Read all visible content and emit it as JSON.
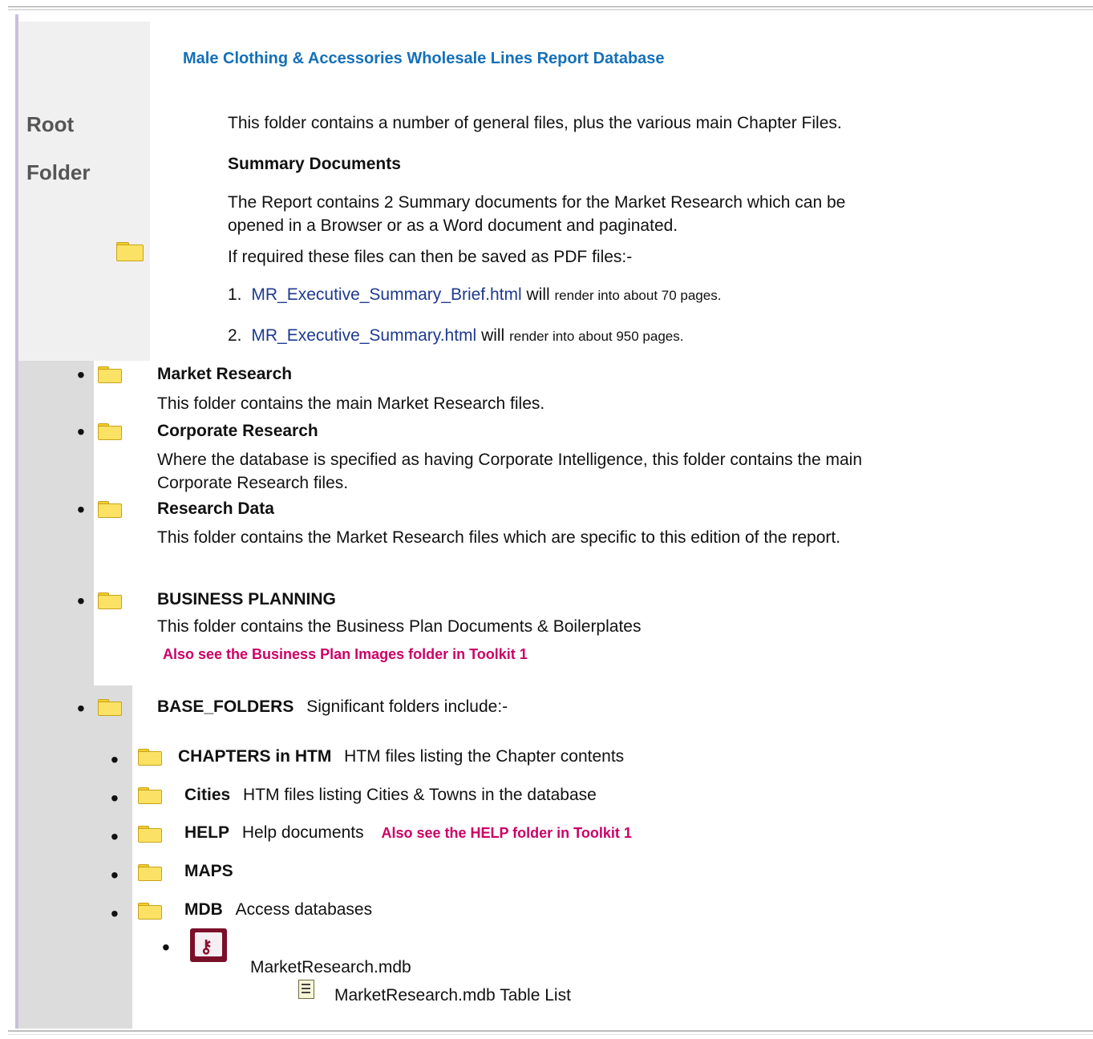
{
  "title": "Male Clothing & Accessories Wholesale Lines Report Database",
  "root_label_1": "Root",
  "root_label_2": "Folder",
  "intro": "This folder contains a number of general files, plus the various main Chapter Files.",
  "summary_heading": "Summary Documents",
  "summary_text_1": "The Report contains 2 Summary documents for the Market Research which can be",
  "summary_text_2": "opened in a Browser or as a Word document and paginated.",
  "pdf_text": "If required these files can then be saved as PDF files:-",
  "summary_files": [
    {
      "num": "1.",
      "link": "MR_Executive_Summary_Brief.html",
      "will": "will",
      "desc": "render into about 70 pages."
    },
    {
      "num": "2.",
      "link": "MR_Executive_Summary.html",
      "will": "will",
      "desc": "render into about 950 pages."
    }
  ],
  "folders": [
    {
      "name": "Market Research",
      "desc_1": "This folder contains the main Market Research files.",
      "desc_2": ""
    },
    {
      "name": "Corporate Research",
      "desc_1": "Where the database is specified as having Corporate Intelligence, this folder contains the main",
      "desc_2": "Corporate Research files."
    },
    {
      "name": "Research Data",
      "desc_1": "This folder contains the Market Research files which are specific to this edition of the report.",
      "desc_2": ""
    },
    {
      "name": "BUSINESS PLANNING",
      "desc_1": "This folder contains the Business Plan Documents & Boilerplates",
      "note": "Also see the Business Plan Images folder in Toolkit 1"
    },
    {
      "name": "BASE_FOLDERS",
      "desc_1": "Significant folders include:-"
    }
  ],
  "subfolders": [
    {
      "name": "CHAPTERS in HTM",
      "desc": "HTM files listing the Chapter contents",
      "note": ""
    },
    {
      "name": "Cities",
      "desc": "HTM files listing Cities & Towns in the database",
      "note": ""
    },
    {
      "name": "HELP",
      "desc": "Help documents",
      "note": "Also see the HELP folder in Toolkit 1"
    },
    {
      "name": "MAPS",
      "desc": "",
      "note": ""
    },
    {
      "name": "MDB",
      "desc": "Access databases",
      "note": ""
    }
  ],
  "mdb_file": "MarketResearch.mdb",
  "mdb_table_list": "MarketResearch.mdb Table List",
  "bullet": "•"
}
